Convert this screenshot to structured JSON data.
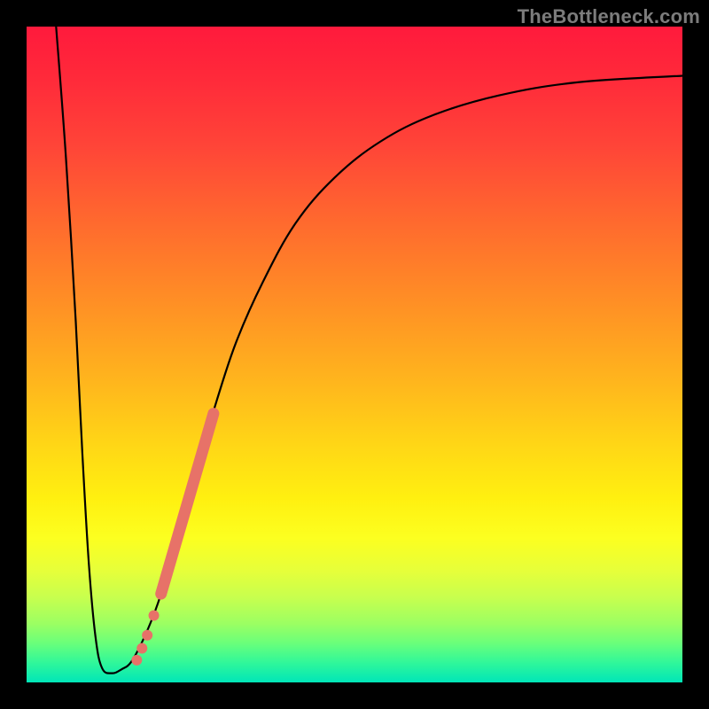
{
  "watermark": "TheBottleneck.com",
  "colors": {
    "curve": "#000000",
    "marker": "#e77268",
    "marker_stroke": "#d95a50"
  },
  "chart_data": {
    "type": "line",
    "title": "",
    "xlabel": "",
    "ylabel": "",
    "xlim": [
      0,
      100
    ],
    "ylim": [
      0,
      100
    ],
    "grid": false,
    "legend": false,
    "curve_points": [
      {
        "x": 4.5,
        "y": 100
      },
      {
        "x": 6.0,
        "y": 80
      },
      {
        "x": 7.5,
        "y": 55
      },
      {
        "x": 8.5,
        "y": 35
      },
      {
        "x": 9.5,
        "y": 18
      },
      {
        "x": 10.5,
        "y": 7
      },
      {
        "x": 11.5,
        "y": 2.2
      },
      {
        "x": 13.0,
        "y": 1.4
      },
      {
        "x": 14.5,
        "y": 2.0
      },
      {
        "x": 16.0,
        "y": 3.2
      },
      {
        "x": 18.0,
        "y": 7
      },
      {
        "x": 20.0,
        "y": 12
      },
      {
        "x": 22.5,
        "y": 20
      },
      {
        "x": 25.0,
        "y": 29
      },
      {
        "x": 27.0,
        "y": 36
      },
      {
        "x": 29.0,
        "y": 43
      },
      {
        "x": 32.0,
        "y": 52
      },
      {
        "x": 36.0,
        "y": 61
      },
      {
        "x": 41.0,
        "y": 70
      },
      {
        "x": 47.0,
        "y": 77
      },
      {
        "x": 54.0,
        "y": 82.5
      },
      {
        "x": 62.0,
        "y": 86.5
      },
      {
        "x": 72.0,
        "y": 89.5
      },
      {
        "x": 84.0,
        "y": 91.5
      },
      {
        "x": 100.0,
        "y": 92.5
      }
    ],
    "series": [
      {
        "name": "highlighted-segment",
        "style": "thick-line",
        "values": [
          {
            "x": 20.5,
            "y": 13.5
          },
          {
            "x": 28.5,
            "y": 41.0
          }
        ]
      },
      {
        "name": "dot-cluster",
        "style": "dots",
        "values": [
          {
            "x": 16.8,
            "y": 3.4
          },
          {
            "x": 17.6,
            "y": 5.2
          },
          {
            "x": 18.4,
            "y": 7.2
          },
          {
            "x": 19.4,
            "y": 10.2
          }
        ]
      }
    ]
  }
}
